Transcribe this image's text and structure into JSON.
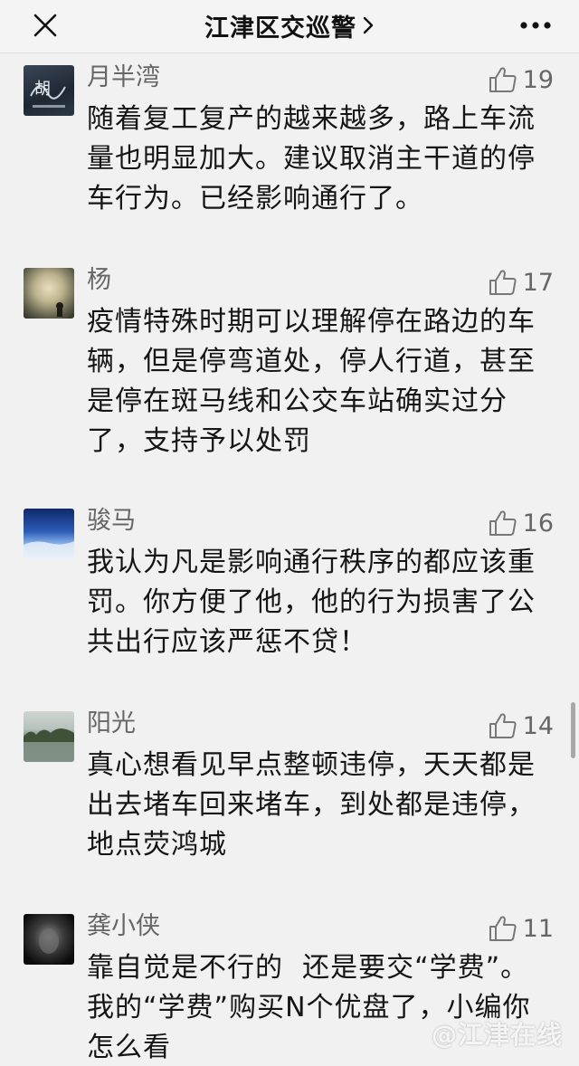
{
  "header": {
    "title": "江津区交巡警",
    "title_chevron": "›",
    "close_icon": "close-icon",
    "more_icon": "more-icon"
  },
  "comments": [
    {
      "user": "月半湾",
      "likes": "19",
      "text": "随着复工复产的越来越多，路上车流量也明显加大。建议取消主干道的停车行为。已经影响通行了。",
      "avatar_text": "胡"
    },
    {
      "user": "杨",
      "likes": "17",
      "text": "疫情特殊时期可以理解停在路边的车辆，但是停弯道处，停人行道，甚至是停在斑马线和公交车站确实过分了，支持予以处罚"
    },
    {
      "user": "骏马",
      "likes": "16",
      "text": "我认为凡是影响通行秩序的都应该重罚。你方便了他，他的行为损害了公共出行应该严惩不贷！"
    },
    {
      "user": "阳光",
      "likes": "14",
      "text": "真心想看见早点整顿违停，天天都是出去堵车回来堵车，到处都是违停，地点荧鸿城"
    },
    {
      "user": "龚小侠",
      "likes": "11",
      "text": "靠自觉是不行的  还是要交“学费”。我的“学费”购买N个优盘了，小编你怎么看"
    }
  ],
  "watermark": "@江津在线",
  "colors": {
    "background": "#f1f1f1",
    "text": "#151515",
    "meta": "#666666"
  }
}
